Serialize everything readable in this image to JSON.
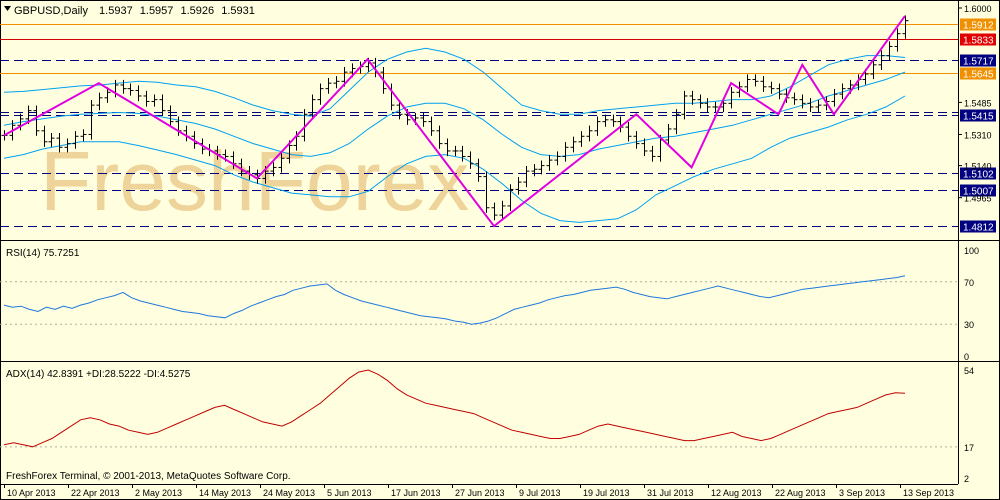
{
  "header": {
    "symbol": "GBPUSD",
    "timeframe": "Daily",
    "ohlc": [
      "1.5937",
      "1.5957",
      "1.5926",
      "1.5931"
    ],
    "menu_icon": "triangle-down-icon"
  },
  "watermark": "FreshForex",
  "footer": "FreshForex Terminal, © 2001-2013, MetaQuotes Software Corp.",
  "colors": {
    "background": "#ffffe0",
    "candles": "#000000",
    "bollinger": "#00a0f0",
    "zigzag": "#e000e0",
    "resistance_line": "#d00000",
    "support_line_orange": "#f09000",
    "dashed_level": "#000080",
    "rsi": "#1e78dc",
    "adx": "#c00000",
    "adx_di_plus": "#9aa048",
    "adx_di_minus": "#c8a8a0",
    "label_box": "#000080",
    "label_text": "#ffffff",
    "label_red": "#e00000",
    "label_orange": "#f09000"
  },
  "chart_data": [
    {
      "type": "line",
      "subtype": "candlestick",
      "title": "GBPUSD,Daily",
      "ylim": [
        1.4745,
        1.6
      ],
      "y_ticks": [
        "1.6000",
        "1.5485",
        "1.5310",
        "1.5140",
        "1.4965"
      ],
      "x_ticks": [
        "10 Apr 2013",
        "22 Apr 2013",
        "2 May 2013",
        "14 May 2013",
        "24 May 2013",
        "5 Jun 2013",
        "17 Jun 2013",
        "27 Jun 2013",
        "9 Jul 2013",
        "19 Jul 2013",
        "31 Jul 2013",
        "12 Aug 2013",
        "22 Aug 2013",
        "3 Sep 2013",
        "13 Sep 2013"
      ],
      "levels": [
        {
          "value": "1.5912",
          "price": 1.5912,
          "style": "solid",
          "color": "#f09000",
          "label": "orange"
        },
        {
          "value": "1.5833",
          "price": 1.5833,
          "style": "solid",
          "color": "#d00000",
          "label": "red"
        },
        {
          "value": "1.5717",
          "price": 1.5717,
          "style": "dashed",
          "color": "#000080",
          "label": "navy"
        },
        {
          "value": "1.5645",
          "price": 1.5645,
          "style": "solid",
          "color": "#f09000",
          "label": "orange"
        },
        {
          "value": "1.5415",
          "price": 1.5415,
          "style": "double-dashed",
          "color": "#000080",
          "label": "navy"
        },
        {
          "value": "1.5102",
          "price": 1.5102,
          "style": "dashed",
          "color": "#000080",
          "label": "navy"
        },
        {
          "value": "1.5007",
          "price": 1.5007,
          "style": "dashed",
          "color": "#000080",
          "label": "navy"
        },
        {
          "value": "1.4812",
          "price": 1.4812,
          "style": "dashed",
          "color": "#000080",
          "label": "navy"
        }
      ],
      "closes": [
        1.5305,
        1.536,
        1.5395,
        1.544,
        1.533,
        1.527,
        1.529,
        1.524,
        1.526,
        1.53,
        1.531,
        1.547,
        1.551,
        1.554,
        1.558,
        1.556,
        1.555,
        1.552,
        1.549,
        1.55,
        1.544,
        1.538,
        1.533,
        1.53,
        1.526,
        1.523,
        1.522,
        1.52,
        1.519,
        1.515,
        1.511,
        1.509,
        1.507,
        1.511,
        1.513,
        1.518,
        1.525,
        1.53,
        1.542,
        1.55,
        1.556,
        1.559,
        1.56,
        1.565,
        1.567,
        1.568,
        1.57,
        1.565,
        1.556,
        1.547,
        1.542,
        1.539,
        1.54,
        1.538,
        1.533,
        1.526,
        1.522,
        1.522,
        1.519,
        1.515,
        1.508,
        1.491,
        1.487,
        1.492,
        1.501,
        1.505,
        1.511,
        1.512,
        1.514,
        1.517,
        1.519,
        1.524,
        1.527,
        1.53,
        1.533,
        1.538,
        1.539,
        1.538,
        1.535,
        1.53,
        1.526,
        1.522,
        1.519,
        1.528,
        1.534,
        1.542,
        1.552,
        1.55,
        1.548,
        1.546,
        1.546,
        1.548,
        1.554,
        1.557,
        1.561,
        1.56,
        1.557,
        1.556,
        1.553,
        1.551,
        1.55,
        1.548,
        1.546,
        1.547,
        1.549,
        1.553,
        1.556,
        1.558,
        1.561,
        1.564,
        1.569,
        1.574,
        1.579,
        1.586,
        1.5931
      ],
      "bollinger_upper": [
        1.554,
        1.5545,
        1.5555,
        1.5565,
        1.5575,
        1.558,
        1.559,
        1.56,
        1.5595,
        1.558,
        1.557,
        1.5545,
        1.551,
        1.547,
        1.544,
        1.542,
        1.541,
        1.545,
        1.555,
        1.565,
        1.572,
        1.576,
        1.578,
        1.576,
        1.572,
        1.565,
        1.556,
        1.547,
        1.544,
        1.542,
        1.542,
        1.544,
        1.545,
        1.546,
        1.547,
        1.548,
        1.548,
        1.549,
        1.55,
        1.55,
        1.552,
        1.557,
        1.563,
        1.569,
        1.572,
        1.574,
        1.574,
        1.573
      ],
      "bollinger_middle": [
        1.536,
        1.538,
        1.5395,
        1.541,
        1.542,
        1.5425,
        1.543,
        1.5425,
        1.541,
        1.539,
        1.537,
        1.534,
        1.53,
        1.526,
        1.523,
        1.52,
        1.519,
        1.521,
        1.526,
        1.534,
        1.541,
        1.546,
        1.548,
        1.548,
        1.545,
        1.539,
        1.531,
        1.524,
        1.52,
        1.519,
        1.52,
        1.523,
        1.525,
        1.527,
        1.529,
        1.53,
        1.532,
        1.534,
        1.536,
        1.539,
        1.542,
        1.545,
        1.548,
        1.552,
        1.555,
        1.558,
        1.561,
        1.565
      ],
      "bollinger_lower": [
        1.518,
        1.52,
        1.523,
        1.525,
        1.527,
        1.527,
        1.527,
        1.525,
        1.5225,
        1.52,
        1.517,
        1.514,
        1.509,
        1.505,
        1.502,
        1.499,
        1.498,
        1.497,
        1.497,
        1.5,
        1.508,
        1.515,
        1.519,
        1.52,
        1.518,
        1.512,
        1.504,
        1.495,
        1.488,
        1.484,
        1.483,
        1.484,
        1.485,
        1.49,
        1.498,
        1.503,
        1.508,
        1.512,
        1.515,
        1.518,
        1.524,
        1.529,
        1.532,
        1.535,
        1.539,
        1.542,
        1.546,
        1.552
      ],
      "zigzag": [
        [
          0,
          1.5305
        ],
        [
          12,
          1.559
        ],
        [
          32,
          1.507
        ],
        [
          46,
          1.572
        ],
        [
          62,
          1.481
        ],
        [
          80,
          1.542
        ],
        [
          87,
          1.513
        ],
        [
          92,
          1.559
        ],
        [
          98,
          1.542
        ],
        [
          101,
          1.569
        ],
        [
          105,
          1.542
        ],
        [
          114,
          1.5957
        ]
      ]
    },
    {
      "type": "line",
      "title": "RSI(14) 75.7251",
      "ylim": [
        0,
        100
      ],
      "y_ticks": [
        "100",
        "70",
        "30",
        "0"
      ],
      "levels": [
        70,
        30
      ],
      "values": [
        48,
        46,
        47,
        44,
        42,
        46,
        44,
        47,
        45,
        48,
        50,
        53,
        55,
        57,
        60,
        55,
        52,
        50,
        48,
        46,
        44,
        42,
        41,
        40,
        38,
        37,
        36,
        40,
        43,
        47,
        50,
        53,
        56,
        58,
        62,
        64,
        66,
        67,
        68,
        62,
        58,
        55,
        52,
        50,
        48,
        46,
        44,
        42,
        40,
        38,
        37,
        36,
        35,
        33,
        32,
        30,
        31,
        33,
        36,
        40,
        44,
        46,
        48,
        50,
        53,
        55,
        57,
        58,
        60,
        62,
        63,
        64,
        65,
        63,
        60,
        58,
        56,
        55,
        54,
        56,
        58,
        60,
        62,
        64,
        66,
        64,
        62,
        60,
        58,
        56,
        55,
        57,
        59,
        61,
        63,
        64,
        65,
        66,
        67,
        68,
        69,
        70,
        71,
        72,
        73,
        74,
        75.7
      ]
    },
    {
      "type": "line",
      "title": "ADX(14) 42.8391 +DI:28.5222 -DI:4.5275",
      "ylim": [
        2,
        54
      ],
      "y_ticks": [
        "54",
        "17",
        "2"
      ],
      "levels": [
        17
      ],
      "values": [
        18,
        19,
        18,
        17,
        19,
        21,
        24,
        27,
        30,
        31,
        30,
        28,
        27,
        25,
        24,
        23,
        24,
        26,
        28,
        30,
        32,
        34,
        36,
        37,
        35,
        33,
        31,
        29,
        28,
        27,
        29,
        32,
        35,
        38,
        42,
        46,
        50,
        53,
        54,
        52,
        49,
        45,
        42,
        40,
        38,
        37,
        36,
        35,
        34,
        33,
        31,
        29,
        27,
        25,
        24,
        23,
        22,
        21,
        21,
        22,
        23,
        25,
        27,
        28,
        27,
        26,
        25,
        24,
        23,
        22,
        21,
        20,
        20,
        21,
        22,
        23,
        24,
        22,
        21,
        20,
        21,
        23,
        25,
        27,
        29,
        31,
        33,
        34,
        35,
        36,
        38,
        40,
        42,
        43,
        42.8
      ]
    }
  ]
}
